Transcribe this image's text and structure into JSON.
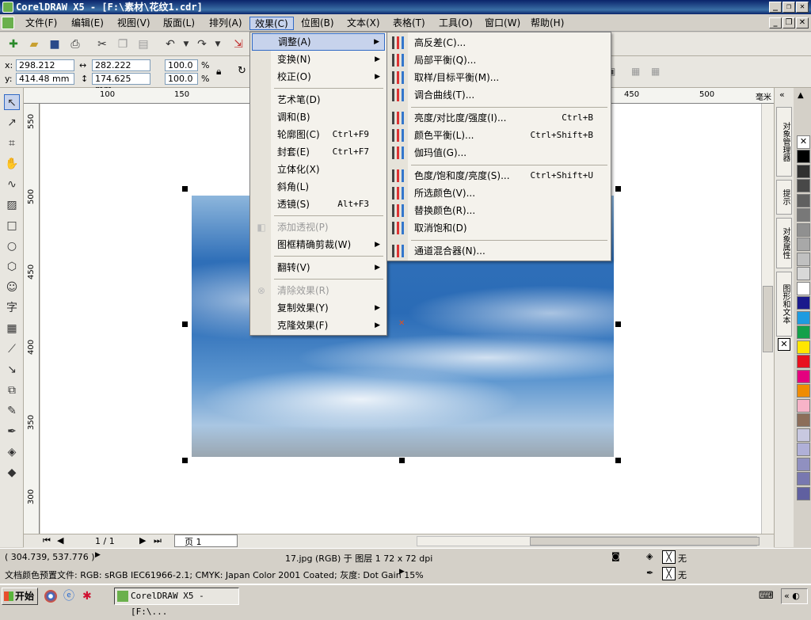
{
  "window": {
    "title": "CorelDRAW X5 - [F:\\素材\\花纹1.cdr]"
  },
  "menubar": [
    {
      "label": "文件(F)"
    },
    {
      "label": "编辑(E)"
    },
    {
      "label": "视图(V)"
    },
    {
      "label": "版面(L)"
    },
    {
      "label": "排列(A)"
    },
    {
      "label": "效果(C)"
    },
    {
      "label": "位图(B)"
    },
    {
      "label": "文本(X)"
    },
    {
      "label": "表格(T)"
    },
    {
      "label": "工具(O)"
    },
    {
      "label": "窗口(W)"
    },
    {
      "label": "帮助(H)"
    }
  ],
  "propbar": {
    "x_label": "x:",
    "x_value": "298.212 mm",
    "y_label": "y:",
    "y_value": "414.48 mm",
    "w_value": "282.222 mm",
    "h_value": "174.625 mm",
    "scale_x": "100.0",
    "scale_y": "100.0",
    "pct": "%"
  },
  "ruler": {
    "h_ticks": [
      "100",
      "150",
      "450",
      "500",
      "毫米"
    ],
    "v_ticks": [
      "550",
      "500",
      "450",
      "400",
      "350",
      "300"
    ]
  },
  "effects_menu": [
    {
      "label": "调整(A)",
      "submenu": true,
      "highlight": true
    },
    {
      "label": "变换(N)",
      "submenu": true
    },
    {
      "label": "校正(O)",
      "submenu": true
    },
    {
      "label": "艺术笔(D)"
    },
    {
      "label": "调和(B)"
    },
    {
      "label": "轮廓图(C)",
      "shortcut": "Ctrl+F9"
    },
    {
      "label": "封套(E)",
      "shortcut": "Ctrl+F7"
    },
    {
      "label": "立体化(X)"
    },
    {
      "label": "斜角(L)"
    },
    {
      "label": "透镜(S)",
      "shortcut": "Alt+F3"
    },
    {
      "label": "添加透视(P)",
      "disabled": true
    },
    {
      "label": "图框精确剪裁(W)",
      "submenu": true
    },
    {
      "label": "翻转(V)",
      "submenu": true
    },
    {
      "label": "清除效果(R)",
      "disabled": true
    },
    {
      "label": "复制效果(Y)",
      "submenu": true
    },
    {
      "label": "克隆效果(F)",
      "submenu": true
    }
  ],
  "adjust_submenu": [
    {
      "label": "高反差(C)..."
    },
    {
      "label": "局部平衡(Q)..."
    },
    {
      "label": "取样/目标平衡(M)..."
    },
    {
      "label": "调合曲线(T)..."
    },
    {
      "label": "亮度/对比度/强度(I)...",
      "shortcut": "Ctrl+B"
    },
    {
      "label": "颜色平衡(L)...",
      "shortcut": "Ctrl+Shift+B"
    },
    {
      "label": "伽玛值(G)..."
    },
    {
      "label": "色度/饱和度/亮度(S)...",
      "shortcut": "Ctrl+Shift+U"
    },
    {
      "label": "所选颜色(V)..."
    },
    {
      "label": "替换颜色(R)..."
    },
    {
      "label": "取消饱和(D)"
    },
    {
      "label": "通道混合器(N)..."
    }
  ],
  "pagenav": {
    "page_count": "1 / 1",
    "page_tab": "页 1"
  },
  "dockers": [
    "对象管理器",
    "提示",
    "对象属性",
    "图形和文本"
  ],
  "palette_colors": [
    "#000000",
    "#303030",
    "#484848",
    "#606060",
    "#787878",
    "#909090",
    "#a8a8a8",
    "#c0c0c0",
    "#d8d8d8",
    "#ffffff",
    "#1a1a8c",
    "#1e9be0",
    "#13a04a",
    "#ffe600",
    "#e8101e",
    "#e4007f",
    "#f08c00",
    "#f7b3c8",
    "#8c6e5a",
    "#c8c8e0",
    "#b0b0d8",
    "#9090c0",
    "#7878b0",
    "#6060a0"
  ],
  "status": {
    "coords": "( 304.739, 537.776 )",
    "object_info": "17.jpg (RGB) 于 图层 1 72 x 72 dpi",
    "color_profile": "文档颜色预置文件: RGB: sRGB IEC61966-2.1; CMYK: Japan Color 2001 Coated; 灰度: Dot Gain 15%",
    "fill_none": "无",
    "outline_none": "无"
  },
  "taskbar": {
    "start": "开始",
    "item": "CorelDRAW X5 - [F:\\..."
  }
}
